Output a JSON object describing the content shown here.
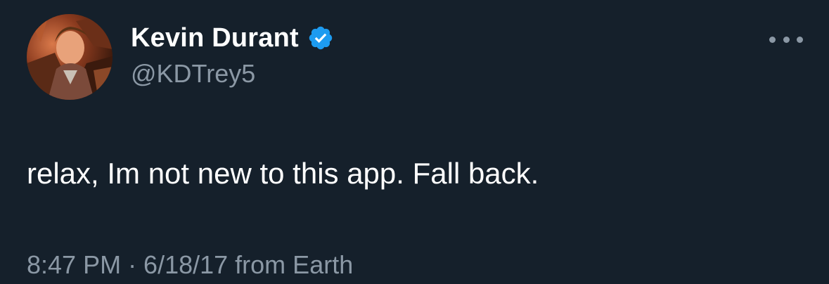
{
  "tweet": {
    "author": {
      "display_name": "Kevin Durant",
      "handle": "@KDTrey5",
      "verified": true,
      "verified_icon": "verified-badge-icon",
      "avatar": "profile-avatar"
    },
    "more_icon": "more-options-icon",
    "text": "relax, Im not new to this app. Fall back.",
    "meta": {
      "timestamp": "8:47 PM · 6/18/17 from Earth"
    }
  },
  "colors": {
    "background": "#15202b",
    "primary_text": "#ffffff",
    "secondary_text": "#8b98a5",
    "verified_blue": "#1d9bf0"
  }
}
